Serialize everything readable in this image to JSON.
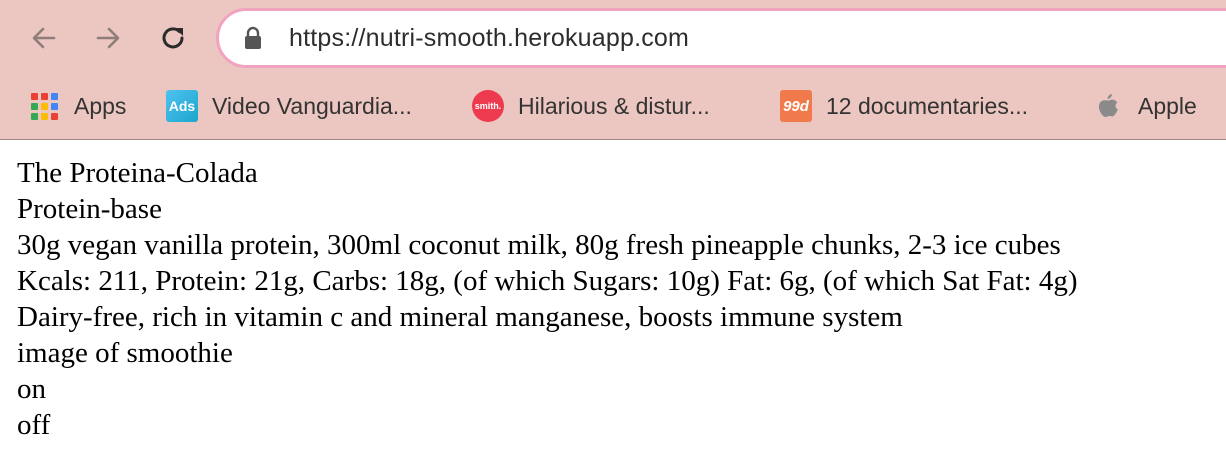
{
  "browser": {
    "url": "https://nutri-smooth.herokuapp.com",
    "nav_icons": [
      "back-arrow-icon",
      "forward-arrow-icon",
      "reload-icon"
    ],
    "bookmarks": [
      {
        "label": "Apps",
        "icon": "apps-grid-icon"
      },
      {
        "label": "Video Vanguardia...",
        "icon": "ads-icon",
        "icon_text": "Ads"
      },
      {
        "label": "Hilarious & distur...",
        "icon": "smith-icon",
        "icon_text": "smith."
      },
      {
        "label": "12 documentaries...",
        "icon": "99d-icon",
        "icon_text": "99d"
      },
      {
        "label": "Apple",
        "icon": "apple-icon"
      }
    ],
    "colors": {
      "toolbar_bg": "#ecc6c0",
      "omnibox_border": "#f2a3c0"
    }
  },
  "page": {
    "title": "The Proteina-Colada",
    "base": "Protein-base",
    "ingredients": "30g vegan vanilla protein, 300ml coconut milk, 80g fresh pineapple chunks, 2-3 ice cubes",
    "nutrition": "Kcals: 211, Protein: 21g, Carbs: 18g, (of which Sugars: 10g) Fat: 6g, (of which Sat Fat: 4g)",
    "benefits": "Dairy-free, rich in vitamin c and mineral manganese, boosts immune system",
    "image_alt": "image of smoothie",
    "toggle_on": "on",
    "toggle_off": "off"
  }
}
